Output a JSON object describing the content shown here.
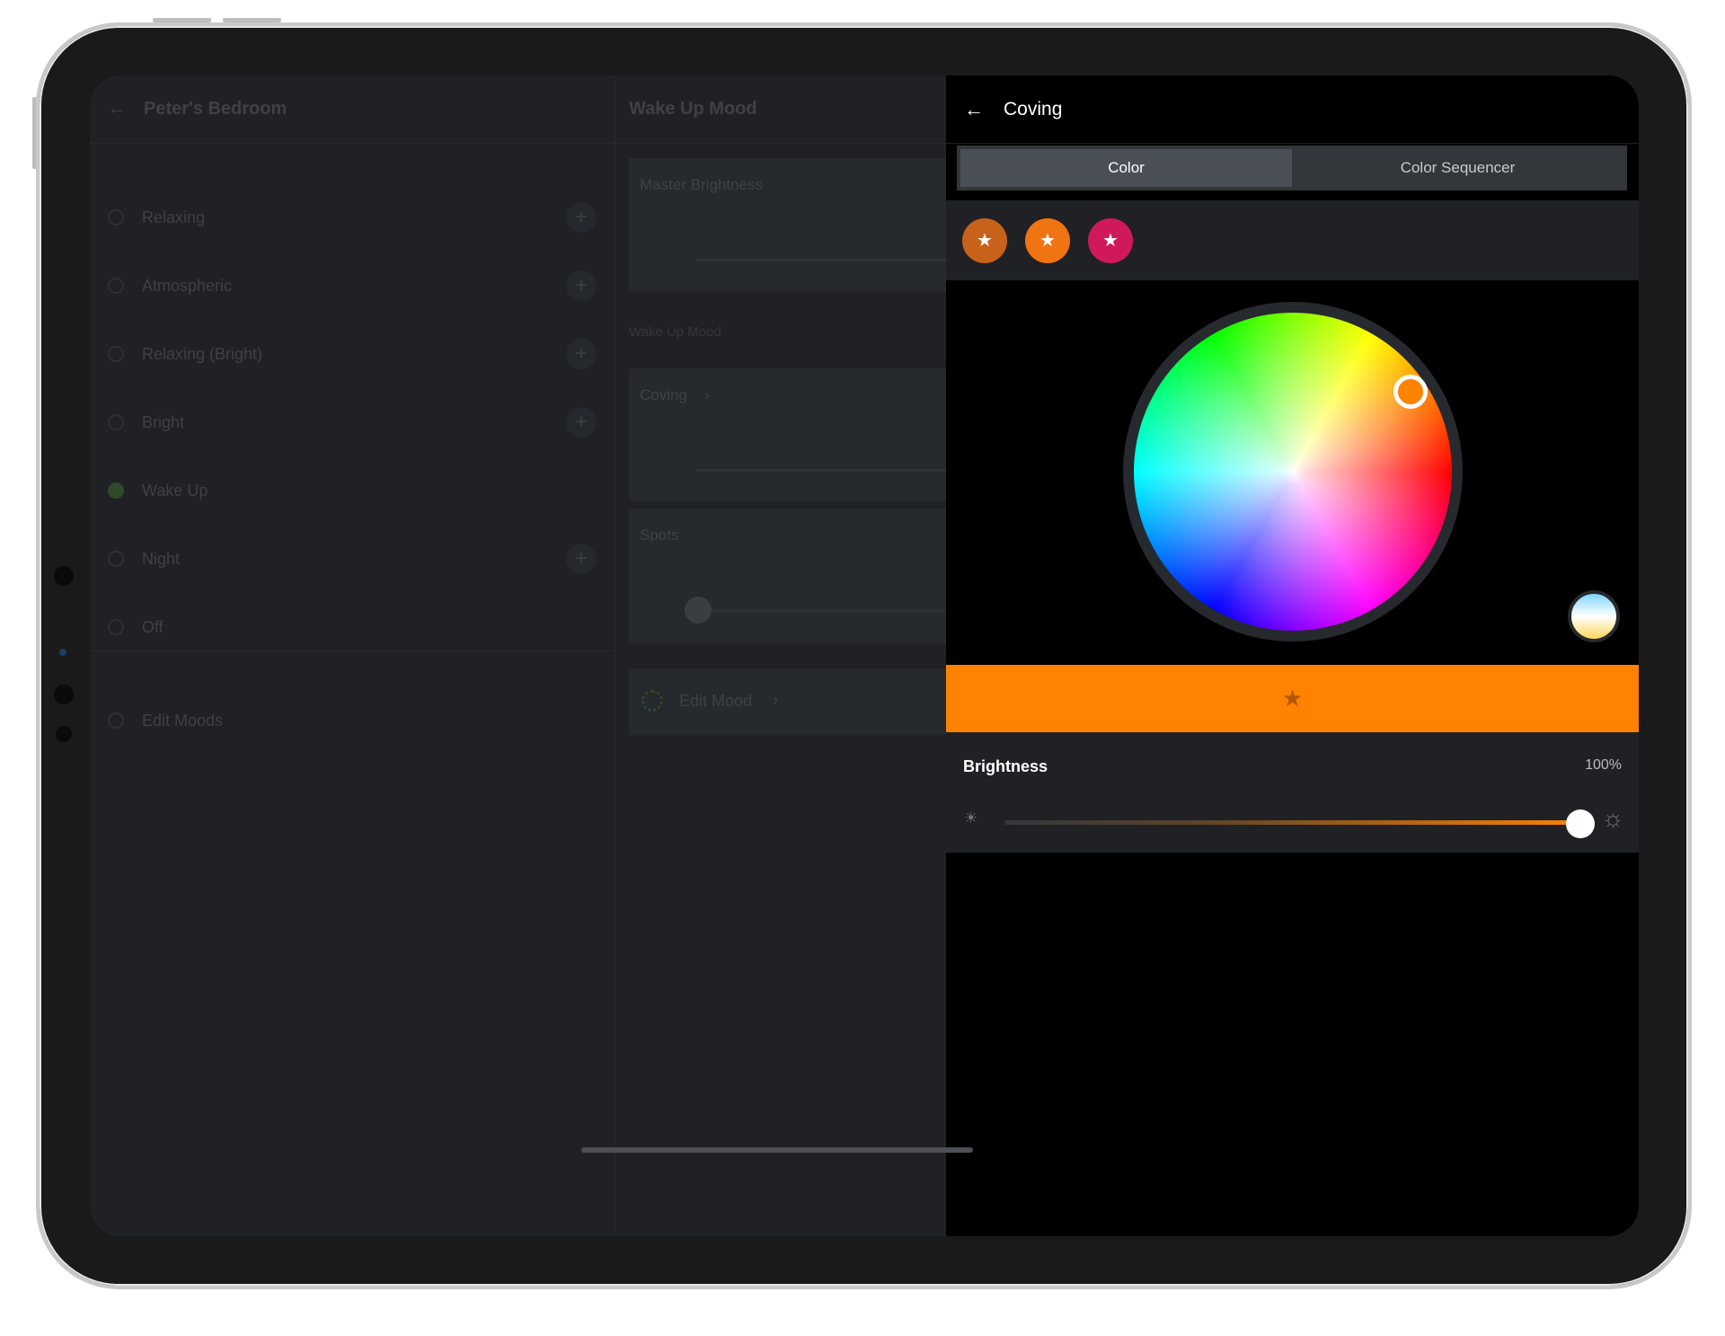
{
  "background_app": {
    "room_title": "Peter's Bedroom",
    "moods": [
      {
        "label": "Relaxing",
        "active": false,
        "has_add": true
      },
      {
        "label": "Atmospheric",
        "active": false,
        "has_add": true
      },
      {
        "label": "Relaxing (Bright)",
        "active": false,
        "has_add": true
      },
      {
        "label": "Bright",
        "active": false,
        "has_add": true
      },
      {
        "label": "Wake Up",
        "active": true,
        "has_add": false
      },
      {
        "label": "Night",
        "active": false,
        "has_add": true
      },
      {
        "label": "Off",
        "active": false,
        "has_add": false
      }
    ],
    "edit_moods_label": "Edit Moods",
    "mood_title": "Wake Up Mood",
    "master_brightness_label": "Master Brightness",
    "section_label": "Wake Up Mood",
    "coving_label": "Coving",
    "spots_label": "Spots",
    "edit_mood_label": "Edit Mood"
  },
  "panel": {
    "title": "Coving",
    "tabs": [
      {
        "label": "Color",
        "active": true
      },
      {
        "label": "Color Sequencer",
        "active": false
      }
    ],
    "favorites": [
      {
        "color": "#c8611a",
        "icon": "star-icon"
      },
      {
        "color": "#f07411",
        "icon": "star-icon"
      },
      {
        "color": "#d0195a",
        "icon": "star-icon"
      }
    ],
    "selected_color": "#ff8200",
    "brightness_label": "Brightness",
    "brightness_value": "100%",
    "brightness_level": 1.0
  }
}
